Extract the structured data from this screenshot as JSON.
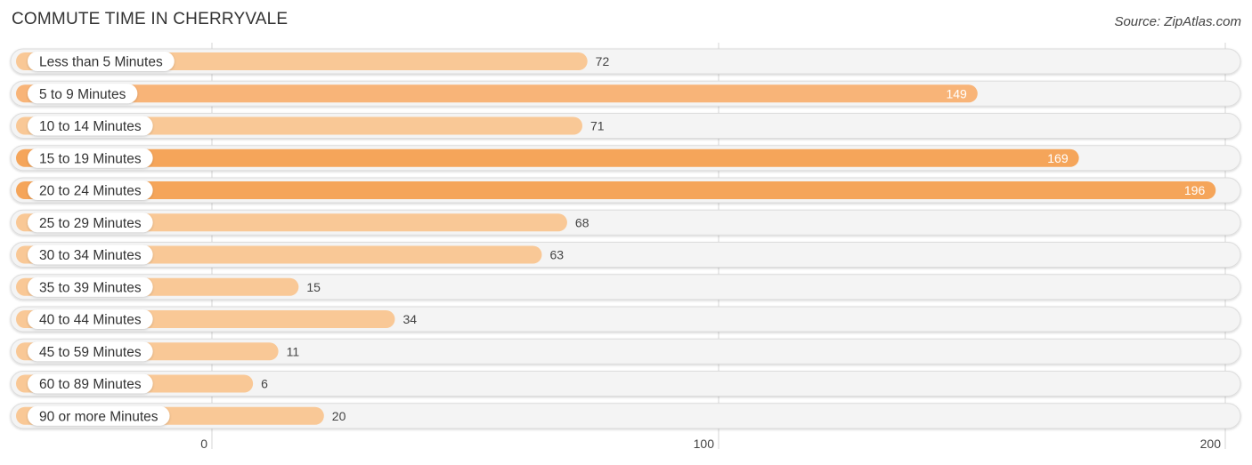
{
  "header": {
    "title": "COMMUTE TIME IN CHERRYVALE",
    "source": "Source: ZipAtlas.com"
  },
  "chart_data": {
    "type": "bar",
    "orientation": "horizontal",
    "title": "COMMUTE TIME IN CHERRYVALE",
    "xlabel": "",
    "ylabel": "",
    "xlim": [
      0,
      200
    ],
    "xticks": [
      0,
      100,
      200
    ],
    "xtick_labels": [
      "0",
      "100",
      "200"
    ],
    "grid": true,
    "categories": [
      "Less than 5 Minutes",
      "5 to 9 Minutes",
      "10 to 14 Minutes",
      "15 to 19 Minutes",
      "20 to 24 Minutes",
      "25 to 29 Minutes",
      "30 to 34 Minutes",
      "35 to 39 Minutes",
      "40 to 44 Minutes",
      "45 to 59 Minutes",
      "60 to 89 Minutes",
      "90 or more Minutes"
    ],
    "values": [
      72,
      149,
      71,
      169,
      196,
      68,
      63,
      15,
      34,
      11,
      6,
      20
    ],
    "colors": {
      "bar_light": "#f9c896",
      "bar_mid": "#f8b478",
      "bar_strong": "#f5a55a",
      "track": "#f4f4f4",
      "track_border": "#dddddd",
      "label_bg": "#ffffff",
      "value_text_outside": "#444444",
      "value_text_inside": "#ffffff",
      "gridline": "#d6d6d6"
    }
  }
}
